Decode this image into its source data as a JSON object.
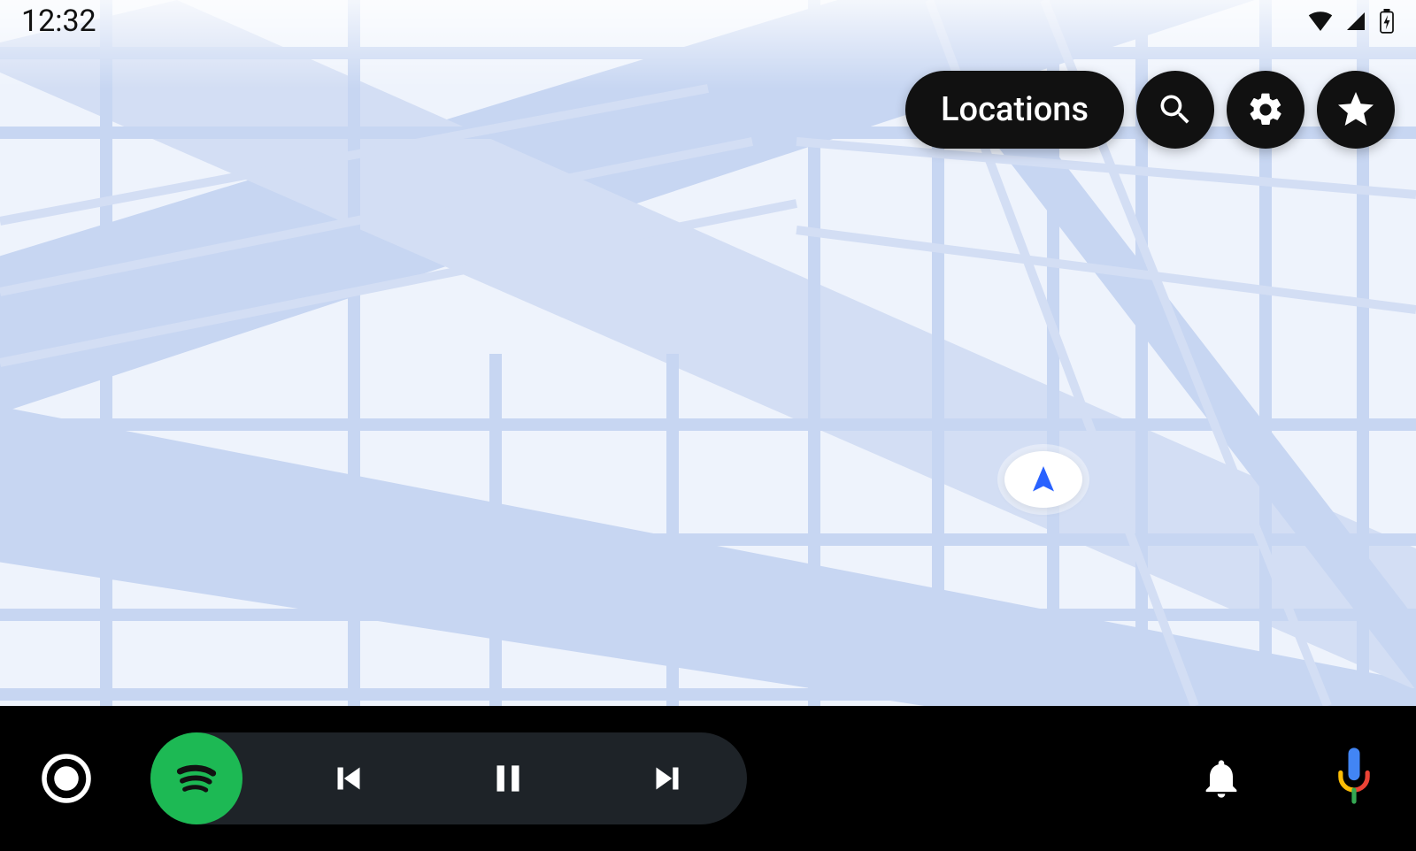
{
  "status": {
    "time": "12:32",
    "wifi": true,
    "cell": true,
    "battery_charging": true
  },
  "top_actions": {
    "locations_label": "Locations",
    "search_icon": "search-icon",
    "settings_icon": "gear-icon",
    "favorites_icon": "star-icon"
  },
  "map": {
    "location_marker_icon": "navigation-arrow-icon"
  },
  "bottom_bar": {
    "home_icon": "home-circle-icon",
    "media_app_icon": "spotify-icon",
    "prev_icon": "skip-previous-icon",
    "play_pause_icon": "pause-icon",
    "next_icon": "skip-next-icon",
    "notifications_icon": "bell-icon",
    "voice_icon": "google-mic-icon"
  },
  "colors": {
    "spotify_green": "#1DB954",
    "map_bg": "#eef3fc",
    "road": "#d3def4",
    "dark_road": "#c3d2ef",
    "marker_blue": "#2962ff"
  }
}
